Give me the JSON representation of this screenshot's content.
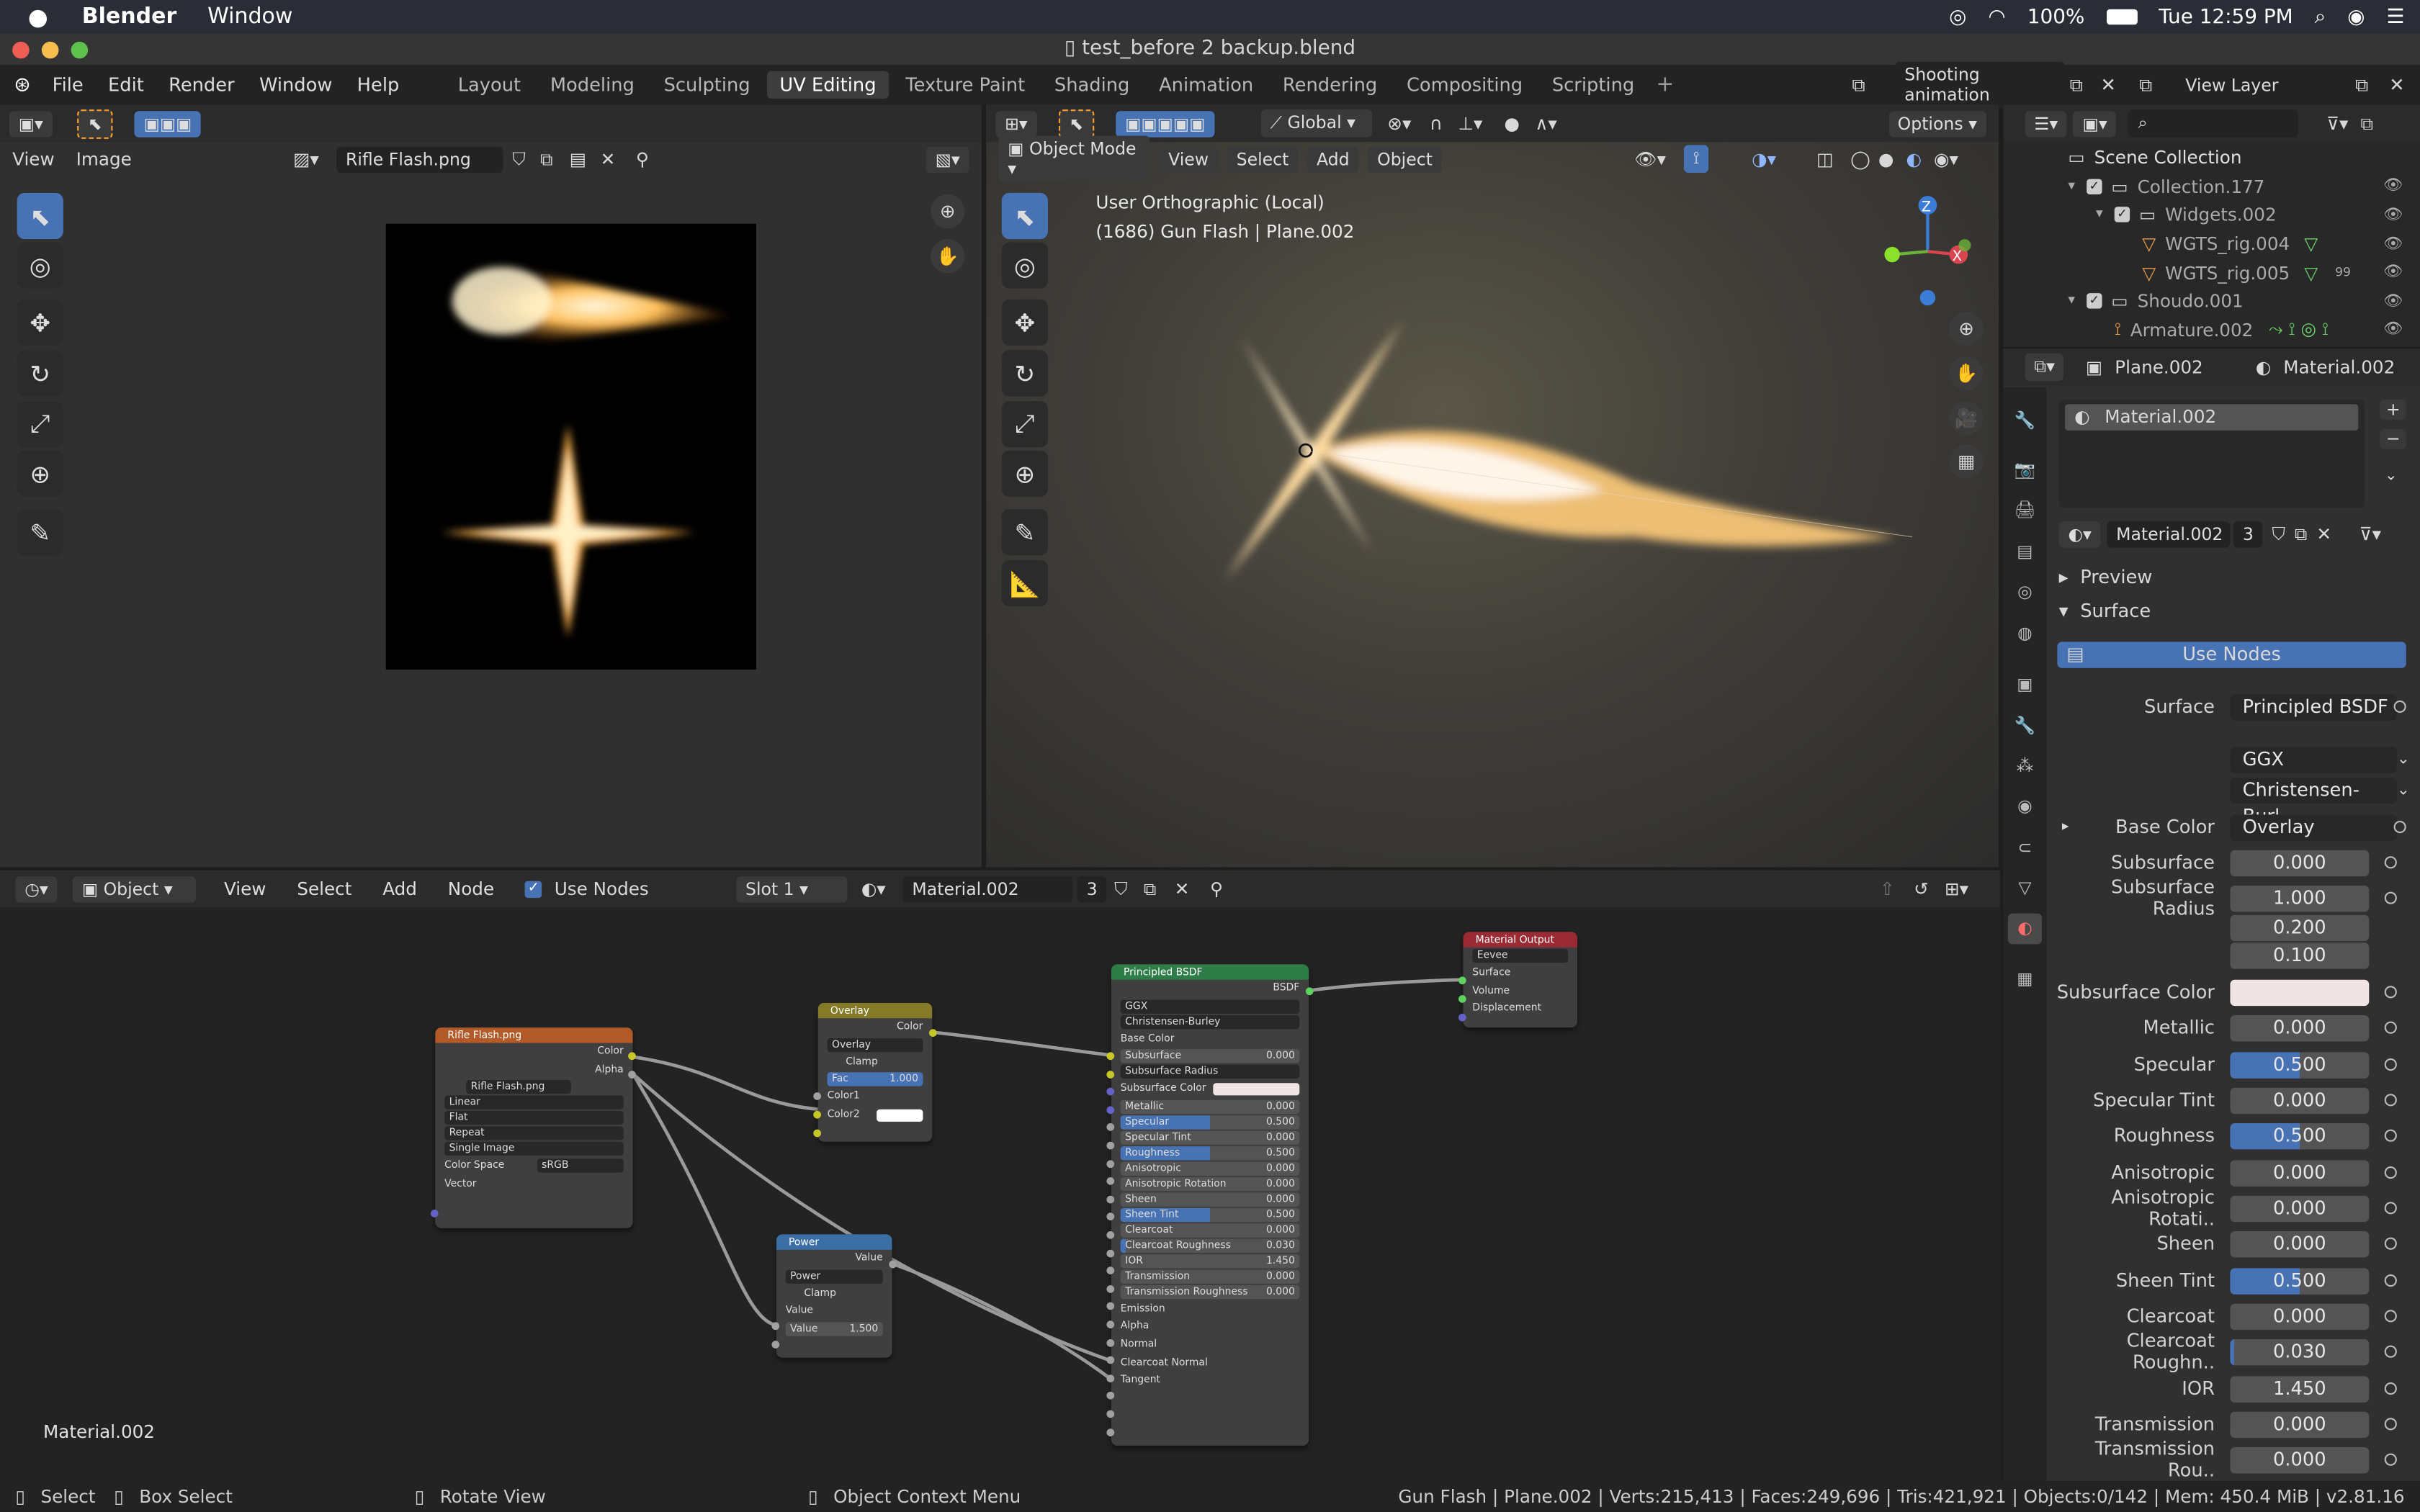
{
  "macbar": {
    "app": "Blender",
    "menu": "Window",
    "battery": "100%",
    "clock": "Tue 12:59 PM"
  },
  "window": {
    "title": "test_before 2 backup.blend"
  },
  "menu": [
    "File",
    "Edit",
    "Render",
    "Window",
    "Help"
  ],
  "workspaces": [
    "Layout",
    "Modeling",
    "Sculpting",
    "UV Editing",
    "Texture Paint",
    "Shading",
    "Animation",
    "Rendering",
    "Compositing",
    "Scripting"
  ],
  "active_workspace": "UV Editing",
  "scene": "Shooting animation",
  "view_layer": "View Layer",
  "image_editor": {
    "view": "View",
    "image": "Image",
    "image_name": "Rifle Flash.png"
  },
  "viewport": {
    "mode": "Object Mode",
    "menus": [
      "View",
      "Select",
      "Add",
      "Object"
    ],
    "transform": "Global",
    "options": "Options",
    "info_line1": "User Orthographic (Local)",
    "info_line2": "(1686) Gun Flash | Plane.002",
    "axis": {
      "z": "Z",
      "x": "X"
    }
  },
  "outliner": {
    "rows": [
      {
        "label": "Scene Collection"
      },
      {
        "label": "Collection.177"
      },
      {
        "label": "Widgets.002"
      },
      {
        "label": "WGTS_rig.004"
      },
      {
        "label": "WGTS_rig.005"
      },
      {
        "label": "Shoudo.001"
      },
      {
        "label": "Armature.002"
      }
    ],
    "badge": "99"
  },
  "props": {
    "object": "Plane.002",
    "material_tab": "Material.002",
    "slot_name": "Material.002",
    "material": "Material.002",
    "users": "3",
    "preview": "Preview",
    "surface_panel": "Surface",
    "use_nodes": "Use Nodes",
    "rows": [
      {
        "label": "Surface",
        "value": "Principled BSDF"
      },
      {
        "label": "",
        "value": "GGX"
      },
      {
        "label": "",
        "value": "Christensen-Burl..."
      },
      {
        "label": "Base Color",
        "value": "Overlay"
      },
      {
        "label": "Subsurface",
        "value": "0.000"
      },
      {
        "label": "Subsurface Radius",
        "value": "1.000"
      },
      {
        "label": "",
        "value": "0.200"
      },
      {
        "label": "",
        "value": "0.100"
      },
      {
        "label": "Subsurface Color",
        "value": ""
      },
      {
        "label": "Metallic",
        "value": "0.000"
      },
      {
        "label": "Specular",
        "value": "0.500"
      },
      {
        "label": "Specular Tint",
        "value": "0.000"
      },
      {
        "label": "Roughness",
        "value": "0.500"
      },
      {
        "label": "Anisotropic",
        "value": "0.000"
      },
      {
        "label": "Anisotropic Rotati..",
        "value": "0.000"
      },
      {
        "label": "Sheen",
        "value": "0.000"
      },
      {
        "label": "Sheen Tint",
        "value": "0.500"
      },
      {
        "label": "Clearcoat",
        "value": "0.000"
      },
      {
        "label": "Clearcoat Roughn..",
        "value": "0.030"
      },
      {
        "label": "IOR",
        "value": "1.450"
      },
      {
        "label": "Transmission",
        "value": "0.000"
      },
      {
        "label": "Transmission Rou..",
        "value": "0.000"
      }
    ]
  },
  "node_editor": {
    "object": "Object",
    "menus": [
      "View",
      "Select",
      "Add",
      "Node"
    ],
    "use_nodes": "Use Nodes",
    "slot": "Slot 1",
    "material": "Material.002",
    "users": "3",
    "footer": "Material.002",
    "tex": {
      "title": "Rifle Flash.png",
      "out_color": "Color",
      "out_alpha": "Alpha",
      "image": "Rifle Flash.png",
      "interp": "Linear",
      "proj": "Flat",
      "ext": "Repeat",
      "src": "Single Image",
      "cs_label": "Color Space",
      "cs": "sRGB",
      "vector": "Vector"
    },
    "overlay": {
      "title": "Overlay",
      "out": "Color",
      "mode": "Overlay",
      "clamp": "Clamp",
      "fac": "Fac",
      "fac_val": "1.000",
      "c1": "Color1",
      "c2": "Color2"
    },
    "power": {
      "title": "Power",
      "out": "Value",
      "op": "Power",
      "clamp": "Clamp",
      "in1": "Value",
      "in2": "Value",
      "in2_val": "1.500"
    },
    "bsdf": {
      "title": "Principled BSDF",
      "out": "BSDF",
      "dist": "GGX",
      "sss": "Christensen-Burley",
      "base": "Base Color",
      "rows": [
        {
          "l": "Subsurface",
          "v": "0.000",
          "f": "0%"
        },
        {
          "l": "Subsurface Radius",
          "v": "",
          "f": "0%",
          "sel": true
        },
        {
          "l": "Subsurface Color",
          "v": "",
          "f": "0%",
          "swatch": true
        },
        {
          "l": "Metallic",
          "v": "0.000",
          "f": "0%"
        },
        {
          "l": "Specular",
          "v": "0.500",
          "f": "50%"
        },
        {
          "l": "Specular Tint",
          "v": "0.000",
          "f": "0%"
        },
        {
          "l": "Roughness",
          "v": "0.500",
          "f": "50%"
        },
        {
          "l": "Anisotropic",
          "v": "0.000",
          "f": "0%"
        },
        {
          "l": "Anisotropic Rotation",
          "v": "0.000",
          "f": "0%"
        },
        {
          "l": "Sheen",
          "v": "0.000",
          "f": "0%"
        },
        {
          "l": "Sheen Tint",
          "v": "0.500",
          "f": "50%"
        },
        {
          "l": "Clearcoat",
          "v": "0.000",
          "f": "0%"
        },
        {
          "l": "Clearcoat Roughness",
          "v": "0.030",
          "f": "3%"
        },
        {
          "l": "IOR",
          "v": "1.450",
          "f": "0%"
        },
        {
          "l": "Transmission",
          "v": "0.000",
          "f": "0%"
        },
        {
          "l": "Transmission Roughness",
          "v": "0.000",
          "f": "0%"
        }
      ],
      "inputs": [
        "Emission",
        "Alpha",
        "Normal",
        "Clearcoat Normal",
        "Tangent"
      ]
    },
    "output": {
      "title": "Material Output",
      "target": "Eevee",
      "in": [
        "Surface",
        "Volume",
        "Displacement"
      ]
    }
  },
  "status": {
    "select": "Select",
    "box": "Box Select",
    "rotate": "Rotate View",
    "ctx": "Object Context Menu",
    "stats": "Gun Flash | Plane.002 | Verts:215,413 | Faces:249,696 | Tris:421,921 | Objects:0/142 | Mem: 450.4 MiB | v2.81.16"
  },
  "colors": {
    "accent": "#4772b3",
    "node_tex": "#b35b28",
    "node_overlay": "#847a28",
    "node_power": "#3a6ea5",
    "node_bsdf": "#2e7d48",
    "node_output": "#9a2b35"
  }
}
